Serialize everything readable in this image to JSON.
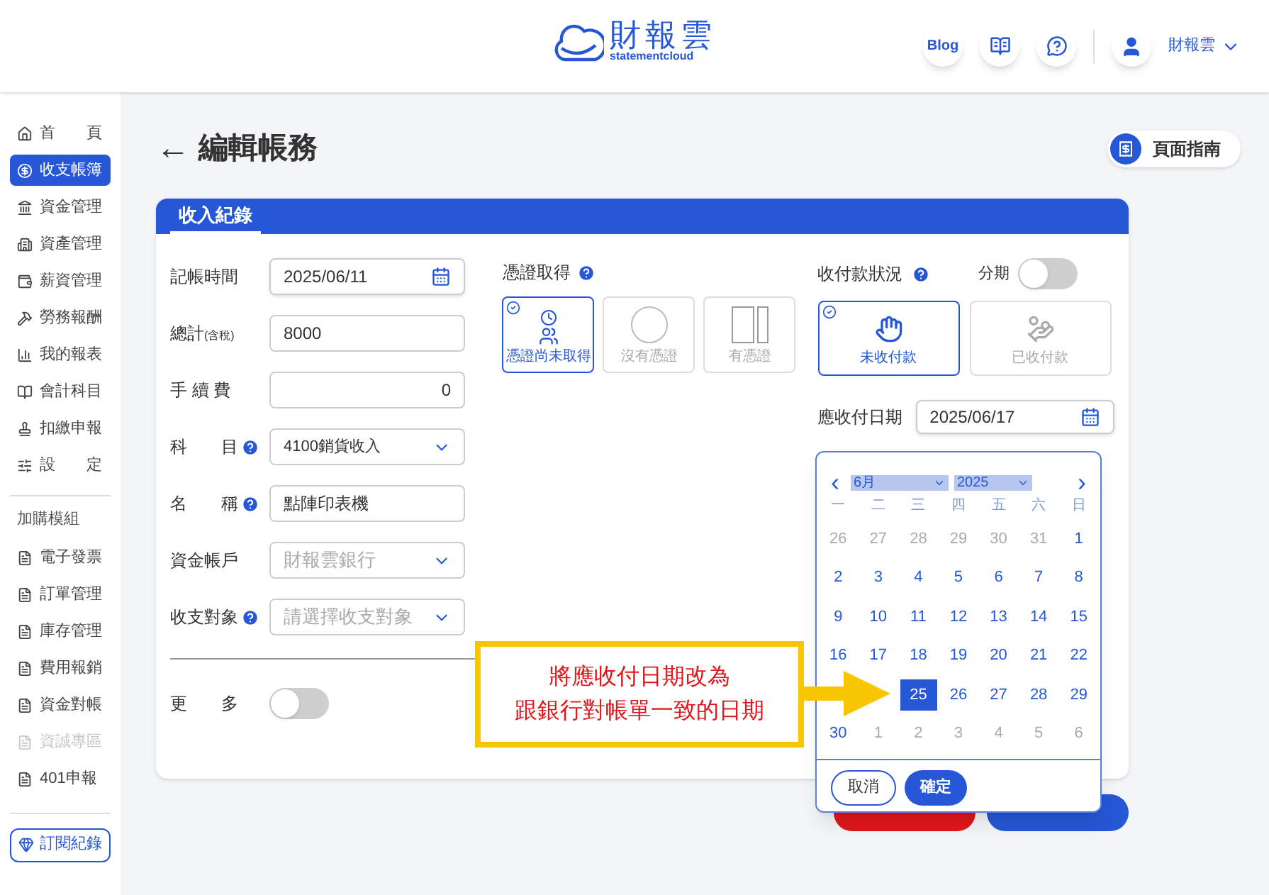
{
  "header": {
    "logo_cn": "財報雲",
    "logo_en": "statementcloud",
    "blog": "Blog",
    "user": "財報雲"
  },
  "sidebar": {
    "items": [
      {
        "label": "首　　頁",
        "selected": false
      },
      {
        "label": "收支帳簿",
        "selected": true
      },
      {
        "label": "資金管理",
        "selected": false
      },
      {
        "label": "資產管理",
        "selected": false
      },
      {
        "label": "薪資管理",
        "selected": false
      },
      {
        "label": "勞務報酬",
        "selected": false
      },
      {
        "label": "我的報表",
        "selected": false
      },
      {
        "label": "會計科目",
        "selected": false
      },
      {
        "label": "扣繳申報",
        "selected": false
      },
      {
        "label": "設　　定",
        "selected": false
      }
    ],
    "addon_heading": "加購模組",
    "addons": [
      {
        "label": "電子發票",
        "disabled": false
      },
      {
        "label": "訂單管理",
        "disabled": false
      },
      {
        "label": "庫存管理",
        "disabled": false
      },
      {
        "label": "費用報銷",
        "disabled": false
      },
      {
        "label": "資金對帳",
        "disabled": false
      },
      {
        "label": "資誠專區",
        "disabled": true
      },
      {
        "label": "401申報",
        "disabled": false
      }
    ],
    "subscription": "訂閱紀錄"
  },
  "page_title": "編輯帳務",
  "back": "←",
  "guide_button": "頁面指南",
  "card": {
    "tab": "收入紀錄",
    "fields": [
      {
        "label": "記帳時間",
        "help": false,
        "kind": "date",
        "value": "2025/06/11"
      },
      {
        "label": "總計",
        "note": "(含稅)",
        "help": false,
        "kind": "text",
        "value": "8000"
      },
      {
        "label": "手 續 費",
        "help": false,
        "kind": "number",
        "value": "0"
      },
      {
        "label": "科　　目",
        "help": true,
        "kind": "select",
        "value": "4100銷貨收入"
      },
      {
        "label": "名　　稱",
        "help": true,
        "kind": "text",
        "value": "點陣印表機"
      },
      {
        "label": "資金帳戶",
        "help": false,
        "kind": "select",
        "placeholder": "財報雲銀行"
      },
      {
        "label": "收支對象",
        "help": true,
        "kind": "select",
        "placeholder": "請選擇收支對象"
      }
    ],
    "more": {
      "label": "更　　多",
      "on": false
    },
    "voucher": {
      "label": "憑證取得",
      "options": [
        {
          "label": "憑證尚未取得",
          "selected": true
        },
        {
          "label": "沒有憑證",
          "selected": false
        },
        {
          "label": "有憑證",
          "selected": false
        }
      ]
    },
    "payment": {
      "label": "收付款狀況",
      "installment": {
        "label": "分期",
        "on": false
      },
      "options": [
        {
          "label": "未收付款",
          "selected": true
        },
        {
          "label": "已收付款",
          "selected": false
        }
      ],
      "due_label": "應收付日期",
      "due_value": "2025/06/17"
    }
  },
  "calendar": {
    "month": "6月",
    "year": "2025",
    "prev": "‹",
    "next": "›",
    "weekdays": [
      "一",
      "二",
      "三",
      "四",
      "五",
      "六",
      "日"
    ],
    "weeks": [
      [
        {
          "d": "26",
          "muted": true,
          "selected": false
        },
        {
          "d": "27",
          "muted": true,
          "selected": false
        },
        {
          "d": "28",
          "muted": true,
          "selected": false
        },
        {
          "d": "29",
          "muted": true,
          "selected": false
        },
        {
          "d": "30",
          "muted": true,
          "selected": false
        },
        {
          "d": "31",
          "muted": true,
          "selected": false
        },
        {
          "d": "1",
          "muted": false,
          "selected": false
        }
      ],
      [
        {
          "d": "2",
          "muted": false,
          "selected": false
        },
        {
          "d": "3",
          "muted": false,
          "selected": false
        },
        {
          "d": "4",
          "muted": false,
          "selected": false
        },
        {
          "d": "5",
          "muted": false,
          "selected": false
        },
        {
          "d": "6",
          "muted": false,
          "selected": false
        },
        {
          "d": "7",
          "muted": false,
          "selected": false
        },
        {
          "d": "8",
          "muted": false,
          "selected": false
        }
      ],
      [
        {
          "d": "9",
          "muted": false,
          "selected": false
        },
        {
          "d": "10",
          "muted": false,
          "selected": false
        },
        {
          "d": "11",
          "muted": false,
          "selected": false
        },
        {
          "d": "12",
          "muted": false,
          "selected": false
        },
        {
          "d": "13",
          "muted": false,
          "selected": false
        },
        {
          "d": "14",
          "muted": false,
          "selected": false
        },
        {
          "d": "15",
          "muted": false,
          "selected": false
        }
      ],
      [
        {
          "d": "16",
          "muted": false,
          "selected": false
        },
        {
          "d": "17",
          "muted": false,
          "selected": false
        },
        {
          "d": "18",
          "muted": false,
          "selected": false
        },
        {
          "d": "19",
          "muted": false,
          "selected": false
        },
        {
          "d": "20",
          "muted": false,
          "selected": false
        },
        {
          "d": "21",
          "muted": false,
          "selected": false
        },
        {
          "d": "22",
          "muted": false,
          "selected": false
        }
      ],
      [
        {
          "d": "25",
          "muted": false,
          "selected": true
        },
        {
          "d": "26",
          "muted": false,
          "selected": false
        },
        {
          "d": "27",
          "muted": false,
          "selected": false
        },
        {
          "d": "28",
          "muted": false,
          "selected": false
        },
        {
          "d": "29",
          "muted": false,
          "selected": false
        }
      ],
      [
        {
          "d": "30",
          "muted": false,
          "selected": false
        },
        {
          "d": "1",
          "muted": true,
          "selected": false
        },
        {
          "d": "2",
          "muted": true,
          "selected": false
        },
        {
          "d": "3",
          "muted": true,
          "selected": false
        },
        {
          "d": "4",
          "muted": true,
          "selected": false
        },
        {
          "d": "5",
          "muted": true,
          "selected": false
        },
        {
          "d": "6",
          "muted": true,
          "selected": false
        }
      ]
    ],
    "cancel": "取消",
    "confirm": "確定"
  },
  "callout": [
    "將應收付日期改為",
    "跟銀行對帳單一致的日期"
  ]
}
